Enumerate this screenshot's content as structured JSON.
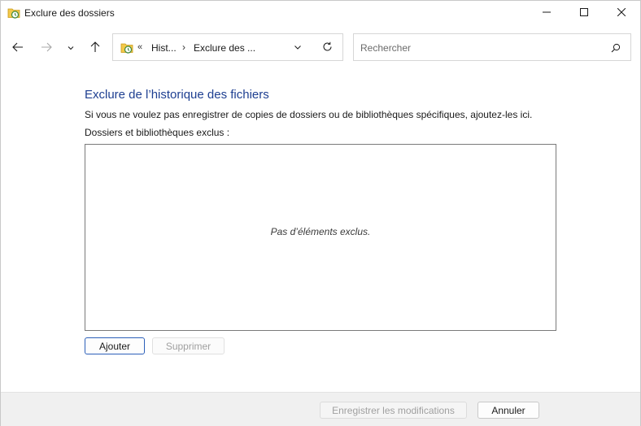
{
  "window": {
    "title": "Exclure des dossiers"
  },
  "addressbar": {
    "overflow_chevron": "«",
    "crumbs": [
      "Hist...",
      "Exclure des ..."
    ],
    "separator": "›"
  },
  "search": {
    "placeholder": "Rechercher"
  },
  "content": {
    "heading": "Exclure de l’historique des fichiers",
    "description": "Si vous ne voulez pas enregistrer de copies de dossiers ou de bibliothèques spécifiques, ajoutez-les ici.",
    "list_label": "Dossiers et bibliothèques exclus :",
    "empty_text": "Pas d’éléments exclus."
  },
  "buttons": {
    "add": "Ajouter",
    "remove": "Supprimer",
    "save": "Enregistrer les modifications",
    "cancel": "Annuler"
  },
  "colors": {
    "heading": "#1e3f91",
    "accent_border": "#2b5fb8",
    "disabled_text": "#a0a0a0",
    "footer_bg": "#f0f0f0"
  },
  "icons": {
    "app": "file-history-icon",
    "minimize": "minimize-icon",
    "maximize": "maximize-icon",
    "close": "close-icon",
    "back": "arrow-left-icon",
    "forward": "arrow-right-icon",
    "recent": "chevron-down-icon",
    "up": "arrow-up-icon",
    "refresh": "refresh-icon",
    "search": "search-icon"
  }
}
